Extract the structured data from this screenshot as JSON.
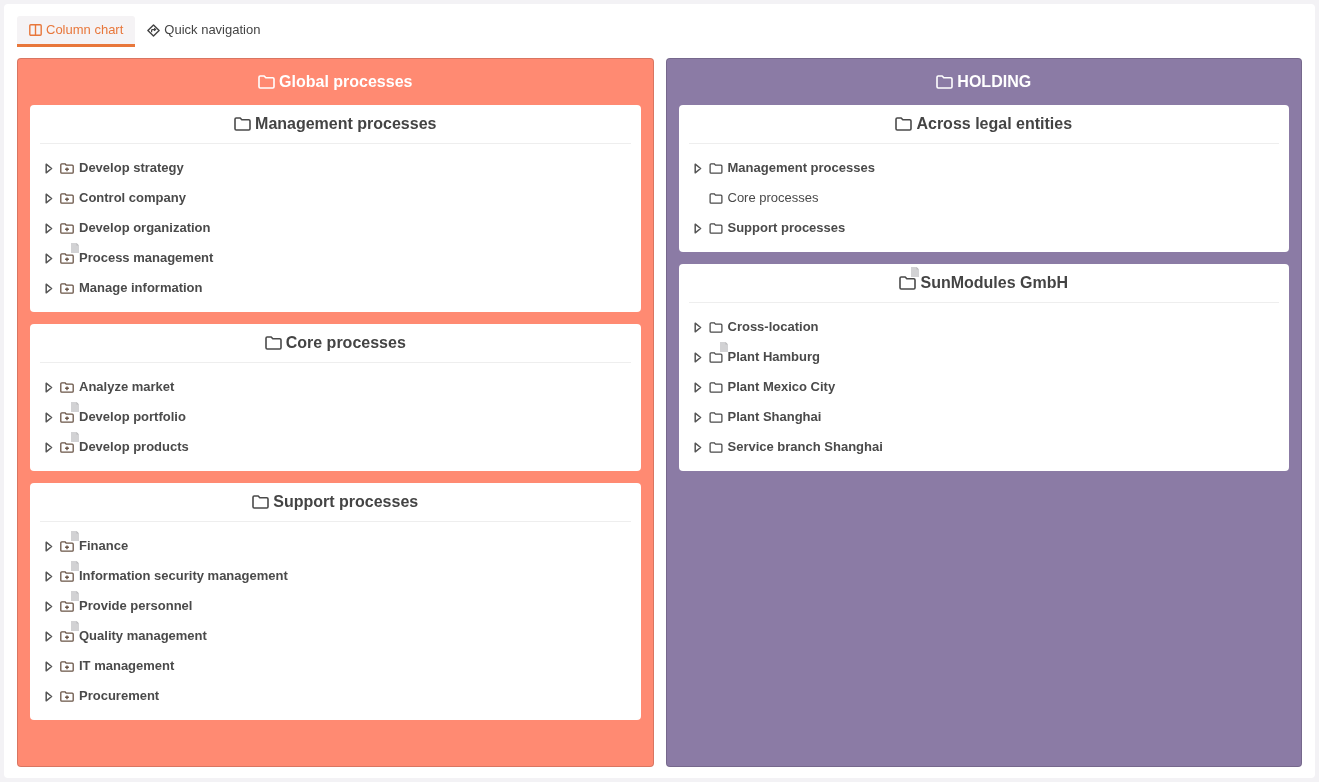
{
  "tabs": [
    {
      "label": "Column chart",
      "selected": true
    },
    {
      "label": "Quick navigation",
      "selected": false
    }
  ],
  "columns": [
    {
      "title": "Global processes",
      "color": "#ff8a72",
      "cards": [
        {
          "title": "Management processes",
          "has_document": false,
          "items": [
            {
              "label": "Develop strategy",
              "kind": "process",
              "expandable": true,
              "has_document": false
            },
            {
              "label": "Control company",
              "kind": "process",
              "expandable": true,
              "has_document": false
            },
            {
              "label": "Develop organization",
              "kind": "process",
              "expandable": true,
              "has_document": false
            },
            {
              "label": "Process management",
              "kind": "process",
              "expandable": true,
              "has_document": true
            },
            {
              "label": "Manage information",
              "kind": "process",
              "expandable": true,
              "has_document": false
            }
          ]
        },
        {
          "title": "Core processes",
          "has_document": false,
          "items": [
            {
              "label": "Analyze market",
              "kind": "process",
              "expandable": true,
              "has_document": false
            },
            {
              "label": "Develop portfolio",
              "kind": "process",
              "expandable": true,
              "has_document": true
            },
            {
              "label": "Develop products",
              "kind": "process",
              "expandable": true,
              "has_document": true
            }
          ]
        },
        {
          "title": "Support processes",
          "has_document": false,
          "items": [
            {
              "label": "Finance",
              "kind": "process",
              "expandable": true,
              "has_document": true
            },
            {
              "label": "Information security management",
              "kind": "process",
              "expandable": true,
              "has_document": true
            },
            {
              "label": "Provide personnel",
              "kind": "process",
              "expandable": true,
              "has_document": true
            },
            {
              "label": "Quality management",
              "kind": "process",
              "expandable": true,
              "has_document": true
            },
            {
              "label": "IT management",
              "kind": "process",
              "expandable": true,
              "has_document": false
            },
            {
              "label": "Procurement",
              "kind": "process",
              "expandable": true,
              "has_document": false
            }
          ]
        }
      ]
    },
    {
      "title": "HOLDING",
      "color": "#8b7ba5",
      "cards": [
        {
          "title": "Across legal entities",
          "has_document": false,
          "items": [
            {
              "label": "Management processes",
              "kind": "folder",
              "expandable": true,
              "has_document": false
            },
            {
              "label": "Core processes",
              "kind": "folder",
              "expandable": false,
              "has_document": false
            },
            {
              "label": "Support processes",
              "kind": "folder",
              "expandable": true,
              "has_document": false
            }
          ]
        },
        {
          "title": "SunModules GmbH",
          "has_document": true,
          "items": [
            {
              "label": "Cross-location",
              "kind": "folder",
              "expandable": true,
              "has_document": false
            },
            {
              "label": "Plant Hamburg",
              "kind": "folder",
              "expandable": true,
              "has_document": true
            },
            {
              "label": "Plant Mexico City",
              "kind": "folder",
              "expandable": true,
              "has_document": false
            },
            {
              "label": "Plant Shanghai",
              "kind": "folder",
              "expandable": true,
              "has_document": false
            },
            {
              "label": "Service branch Shanghai",
              "kind": "folder",
              "expandable": true,
              "has_document": false
            }
          ]
        }
      ]
    }
  ]
}
